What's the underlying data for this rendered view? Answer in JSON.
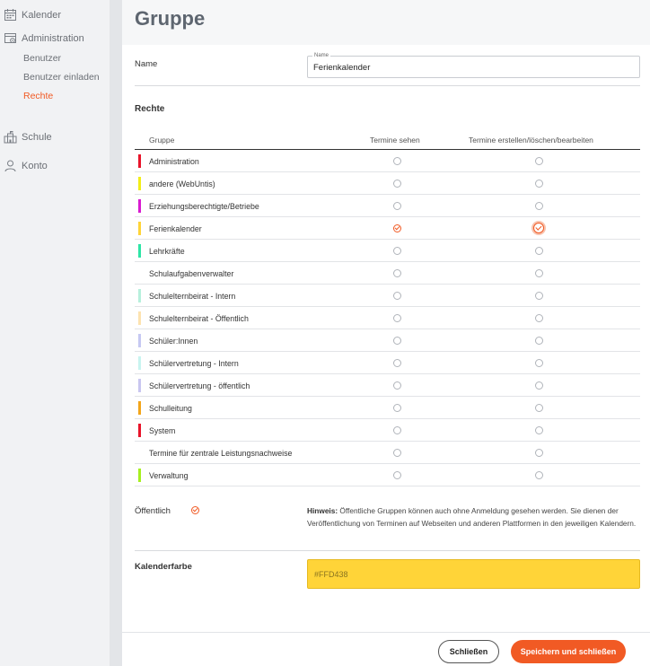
{
  "sidebar": {
    "calendar": "Kalender",
    "administration": "Administration",
    "sub": [
      "Benutzer",
      "Benutzer einladen",
      "Rechte"
    ],
    "school": "Schule",
    "account": "Konto"
  },
  "page": {
    "title": "Gruppe"
  },
  "name_field": {
    "label": "Name",
    "mini_label": "Name",
    "value": "Ferienkalender"
  },
  "rights": {
    "title": "Rechte",
    "columns": [
      "Gruppe",
      "Termine sehen",
      "Termine erstellen/löschen/bearbeiten"
    ],
    "rows": [
      {
        "name": "Administration",
        "color": "#e8142a",
        "see": false,
        "edit": false
      },
      {
        "name": "andere (WebUntis)",
        "color": "#f2ee18",
        "see": false,
        "edit": false
      },
      {
        "name": "Erziehungsberechtigte/Betriebe",
        "color": "#d81bd0",
        "see": false,
        "edit": false
      },
      {
        "name": "Ferienkalender",
        "color": "#ffd438",
        "see": true,
        "edit": true
      },
      {
        "name": "Lehrkräfte",
        "color": "#2ee5a6",
        "see": false,
        "edit": false
      },
      {
        "name": "Schulaufgabenverwalter",
        "color": "",
        "see": false,
        "edit": false
      },
      {
        "name": "Schulelternbeirat - Intern",
        "color": "#b7f0dc",
        "see": false,
        "edit": false
      },
      {
        "name": "Schulelternbeirat - Öffentlich",
        "color": "#fde3b0",
        "see": false,
        "edit": false
      },
      {
        "name": "Schüler:Innen",
        "color": "#c6c9f2",
        "see": false,
        "edit": false
      },
      {
        "name": "Schülervertretung - Intern",
        "color": "#c8f4f0",
        "see": false,
        "edit": false
      },
      {
        "name": "Schülervertretung - öffentlich",
        "color": "#c9c6f0",
        "see": false,
        "edit": false
      },
      {
        "name": "Schulleitung",
        "color": "#f2a51a",
        "see": false,
        "edit": false
      },
      {
        "name": "System",
        "color": "#e8142a",
        "see": false,
        "edit": false
      },
      {
        "name": "Termine für zentrale Leistungsnachweise",
        "color": "",
        "see": false,
        "edit": false
      },
      {
        "name": "Verwaltung",
        "color": "#a6f020",
        "see": false,
        "edit": false
      }
    ]
  },
  "public": {
    "label": "Öffentlich",
    "checked": true,
    "hint_bold": "Hinweis:",
    "hint_text": " Öffentliche Gruppen können auch ohne Anmeldung gesehen werden. Sie dienen der Veröffentlichung von Terminen auf Webseiten und anderen Plattformen in den jeweiligen Kalendern."
  },
  "color_field": {
    "label": "Kalenderfarbe",
    "value": "#FFD438"
  },
  "buttons": {
    "close": "Schließen",
    "save": "Speichern und schließen"
  },
  "colors": {
    "accent": "#f15a24"
  }
}
